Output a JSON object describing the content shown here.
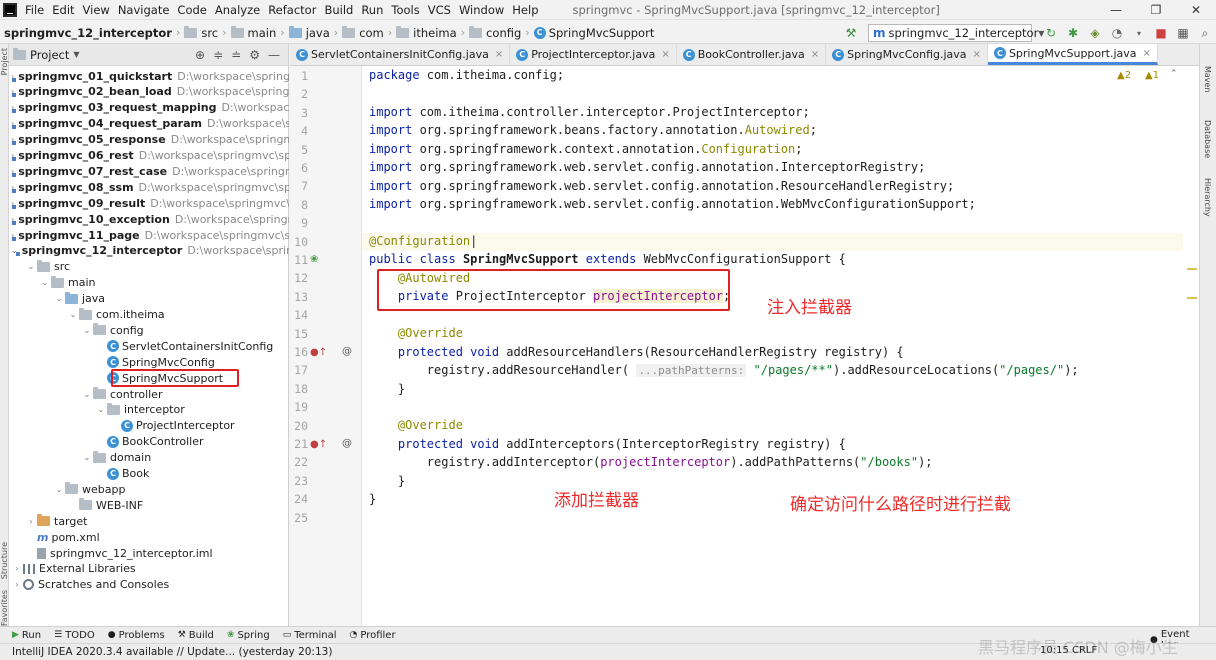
{
  "menubar": {
    "items": [
      "File",
      "Edit",
      "View",
      "Navigate",
      "Code",
      "Analyze",
      "Refactor",
      "Build",
      "Run",
      "Tools",
      "VCS",
      "Window",
      "Help"
    ],
    "window_title": "springmvc - SpringMvcSupport.java [springmvc_12_interceptor]",
    "minimize": "—",
    "maximize": "❐",
    "close": "✕"
  },
  "navbar": {
    "crumbs": [
      "springmvc_12_interceptor",
      "src",
      "main",
      "java",
      "com",
      "itheima",
      "config",
      "SpringMvcSupport"
    ],
    "run_config": "springmvc_12_interceptor"
  },
  "project": {
    "title": "Project",
    "rows": [
      {
        "name": "springmvc_01_quickstart",
        "path": "D:\\workspace\\springmv",
        "bold": true
      },
      {
        "name": "springmvc_02_bean_load",
        "path": "D:\\workspace\\springmv",
        "bold": true
      },
      {
        "name": "springmvc_03_request_mapping",
        "path": "D:\\workspace\\s",
        "bold": true
      },
      {
        "name": "springmvc_04_request_param",
        "path": "D:\\workspace\\spri",
        "bold": true
      },
      {
        "name": "springmvc_05_response",
        "path": "D:\\workspace\\springmvc",
        "bold": true
      },
      {
        "name": "springmvc_06_rest",
        "path": "D:\\workspace\\springmvc\\sprir",
        "bold": true
      },
      {
        "name": "springmvc_07_rest_case",
        "path": "D:\\workspace\\springmvc",
        "bold": true
      },
      {
        "name": "springmvc_08_ssm",
        "path": "D:\\workspace\\springmvc\\sprir",
        "bold": true
      },
      {
        "name": "springmvc_09_result",
        "path": "D:\\workspace\\springmvc\\sp",
        "bold": true
      },
      {
        "name": "springmvc_10_exception",
        "path": "D:\\workspace\\springmv",
        "bold": true
      },
      {
        "name": "springmvc_11_page",
        "path": "D:\\workspace\\springmvc\\spr",
        "bold": true
      },
      {
        "name": "springmvc_12_interceptor",
        "path": "D:\\workspace\\springm",
        "bold": true
      },
      {
        "name": "src"
      },
      {
        "name": "main"
      },
      {
        "name": "java"
      },
      {
        "name": "com.itheima"
      },
      {
        "name": "config"
      },
      {
        "name": "ServletContainersInitConfig"
      },
      {
        "name": "SpringMvcConfig"
      },
      {
        "name": "SpringMvcSupport"
      },
      {
        "name": "controller"
      },
      {
        "name": "interceptor"
      },
      {
        "name": "ProjectInterceptor"
      },
      {
        "name": "BookController"
      },
      {
        "name": "domain"
      },
      {
        "name": "Book"
      },
      {
        "name": "webapp"
      },
      {
        "name": "WEB-INF"
      },
      {
        "name": "target"
      },
      {
        "name": "pom.xml"
      },
      {
        "name": "springmvc_12_interceptor.iml"
      },
      {
        "name": "External Libraries"
      },
      {
        "name": "Scratches and Consoles"
      }
    ]
  },
  "tabs": [
    {
      "label": "ServletContainersInitConfig.java"
    },
    {
      "label": "ProjectInterceptor.java"
    },
    {
      "label": "BookController.java"
    },
    {
      "label": "SpringMvcConfig.java"
    },
    {
      "label": "SpringMvcSupport.java"
    }
  ],
  "editor": {
    "line_numbers": [
      "1",
      "2",
      "3",
      "4",
      "5",
      "6",
      "7",
      "8",
      "9",
      "10",
      "11",
      "12",
      "13",
      "14",
      "15",
      "16",
      "17",
      "18",
      "19",
      "20",
      "21",
      "22",
      "23",
      "24",
      "25"
    ],
    "warnings": "2",
    "weak_warnings": "1",
    "hint_pathPatterns": "...pathPatterns:",
    "annotations": {
      "inject": "注入拦截器",
      "add": "添加拦截器",
      "path": "确定访问什么路径时进行拦截"
    }
  },
  "left_strip": {
    "project": "Project",
    "structure": "Structure",
    "favorites": "Favorites"
  },
  "right_strip": {
    "maven": "Maven",
    "database": "Database",
    "hierarchy": "Hierarchy"
  },
  "bottom_tools": [
    "Run",
    "TODO",
    "Problems",
    "Build",
    "Spring",
    "Terminal",
    "Profiler"
  ],
  "event_log": "Event Log",
  "status": {
    "message": "IntelliJ IDEA 2020.3.4 available // Update... (yesterday 20:13)",
    "position": "10:15",
    "line_sep": "CRLF",
    "watermark": "黑马程序员 CSDN @梅小生"
  }
}
